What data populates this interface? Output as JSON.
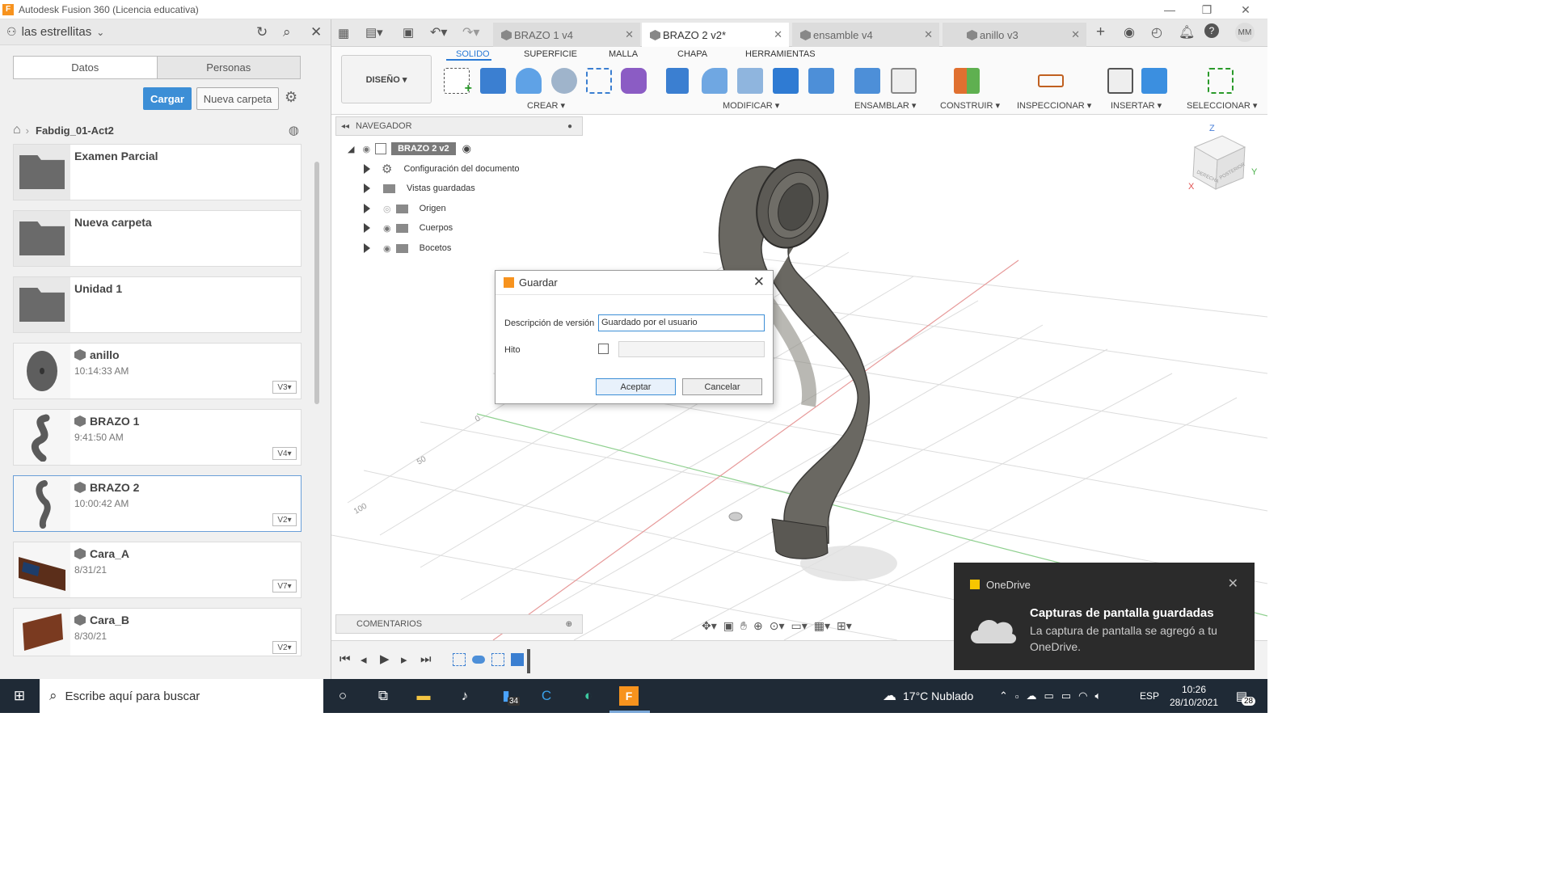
{
  "window": {
    "title": "Autodesk Fusion 360 (Licencia educativa)",
    "minimize": "—",
    "restore": "❐",
    "close": "✕"
  },
  "left": {
    "project": "las estrellitas",
    "tabs": [
      "Datos",
      "Personas"
    ],
    "upload": "Cargar",
    "new_folder": "Nueva carpeta",
    "breadcrumb": "Fabdig_01-Act2",
    "items": [
      {
        "name": "Examen Parcial",
        "time": "",
        "ver": "",
        "type": "folder"
      },
      {
        "name": "Nueva carpeta",
        "time": "",
        "ver": "",
        "type": "folder"
      },
      {
        "name": "Unidad 1",
        "time": "",
        "ver": "",
        "type": "folder"
      },
      {
        "name": "anillo",
        "time": "10:14:33 AM",
        "ver": "V3▾",
        "type": "design"
      },
      {
        "name": "BRAZO 1",
        "time": "9:41:50 AM",
        "ver": "V4▾",
        "type": "design"
      },
      {
        "name": "BRAZO 2",
        "time": "10:00:42 AM",
        "ver": "V2▾",
        "type": "design"
      },
      {
        "name": "Cara_A",
        "time": "8/31/21",
        "ver": "V7▾",
        "type": "design"
      },
      {
        "name": "Cara_B",
        "time": "8/30/21",
        "ver": "V2▾",
        "type": "design"
      }
    ]
  },
  "doc_tabs": [
    {
      "label": "BRAZO 1 v4"
    },
    {
      "label": "BRAZO 2 v2*"
    },
    {
      "label": "ensamble v4"
    },
    {
      "label": "anillo v3"
    }
  ],
  "ribbon": {
    "design": "DISEÑO ▾",
    "tabs": [
      "SOLIDO",
      "SUPERFICIE",
      "MALLA",
      "CHAPA",
      "HERRAMIENTAS"
    ],
    "groups": [
      "CREAR ▾",
      "MODIFICAR ▾",
      "ENSAMBLAR ▾",
      "CONSTRUIR ▾",
      "INSPECCIONAR ▾",
      "INSERTAR ▾",
      "SELECCIONAR ▾"
    ]
  },
  "navigator": {
    "title": "NAVEGADOR",
    "root": "BRAZO 2 v2",
    "nodes": [
      "Configuración del documento",
      "Vistas guardadas",
      "Origen",
      "Cuerpos",
      "Bocetos"
    ]
  },
  "comments": "COMENTARIOS",
  "viewcube": {
    "z": "Z",
    "x": "X",
    "y": "Y",
    "front": "DERECHA",
    "back": "POSTERIOR"
  },
  "grid_labels": [
    "0",
    "50",
    "100"
  ],
  "dialog": {
    "title": "Guardar",
    "desc_label": "Descripción de versión",
    "desc_value": "Guardado por el usuario",
    "milestone_label": "Hito",
    "ok": "Aceptar",
    "cancel": "Cancelar"
  },
  "toast": {
    "app": "OneDrive",
    "heading": "Capturas de pantalla guardadas",
    "body": "La captura de pantalla se agregó a tu OneDrive."
  },
  "taskbar": {
    "search_placeholder": "Escribe aquí para buscar",
    "weather": "17°C  Nublado",
    "lang": "ESP",
    "time": "10:26",
    "date": "28/10/2021",
    "badge": "34",
    "notif": "28"
  },
  "user_initials": "MM",
  "colors": {
    "accent": "#3c8ed6",
    "brand": "#f7931e",
    "taskbar": "#1f2a36",
    "toast": "#2b2b2b"
  }
}
